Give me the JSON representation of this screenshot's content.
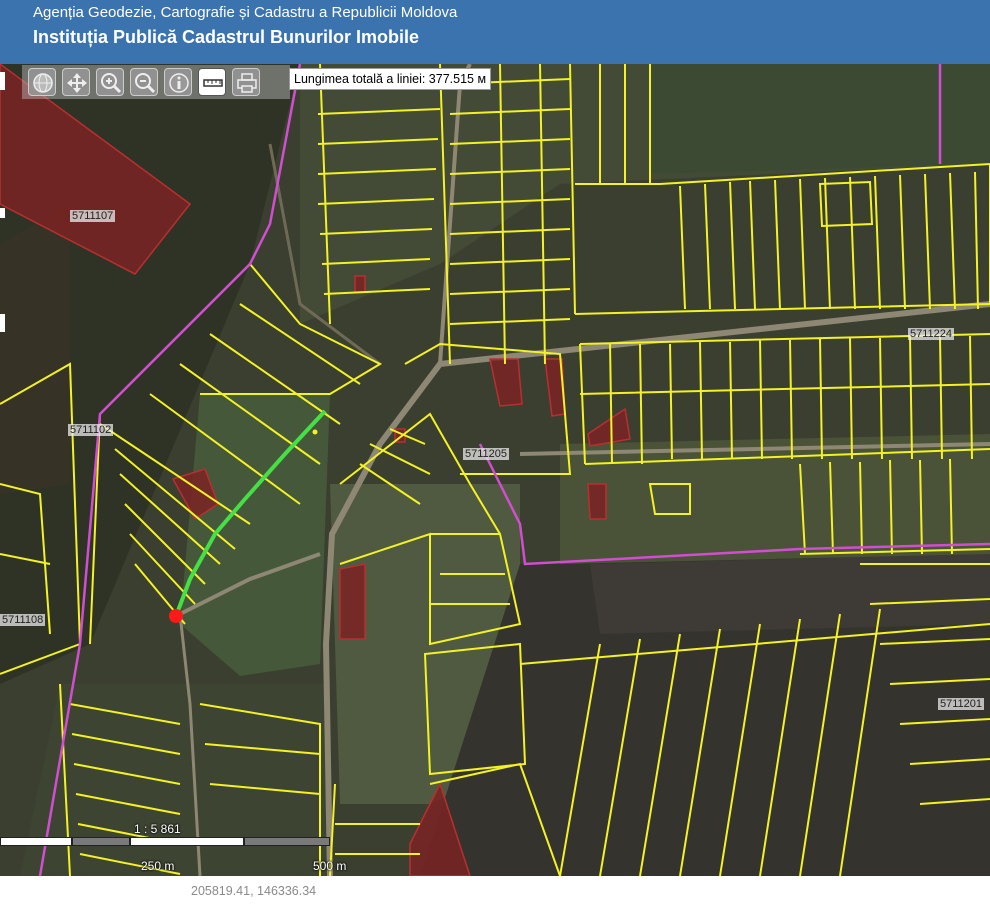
{
  "header": {
    "agency": "Agenția Geodezie, Cartografie și Cadastru a Republicii Moldova",
    "institution": "Instituția Publică Cadastrul Bunurilor Imobile"
  },
  "toolbar": {
    "tools": [
      "globe-icon",
      "pan-icon",
      "zoom-in-icon",
      "zoom-out-icon",
      "info-icon",
      "measure-line-icon",
      "print-icon"
    ],
    "active_tool": "measure-line-icon"
  },
  "measurement": {
    "text": "Lungimea totală a liniei: 377.515 м"
  },
  "parcel_labels": [
    "5711107",
    "5711224",
    "5711102",
    "5711205",
    "5711108",
    "5711201"
  ],
  "scale": {
    "ratio": "1 : 5 861",
    "label_mid": "250 m",
    "label_end": "500 m"
  },
  "coordinates": "205819.41, 146336.34",
  "colors": {
    "header": "#3a73ad",
    "parcel_outline": "#f2f224",
    "highlight_parcel": "#9e2a2a",
    "measured_line": "#46e046",
    "start_point": "#ff1a1a",
    "boundary": "#d04fd0"
  }
}
